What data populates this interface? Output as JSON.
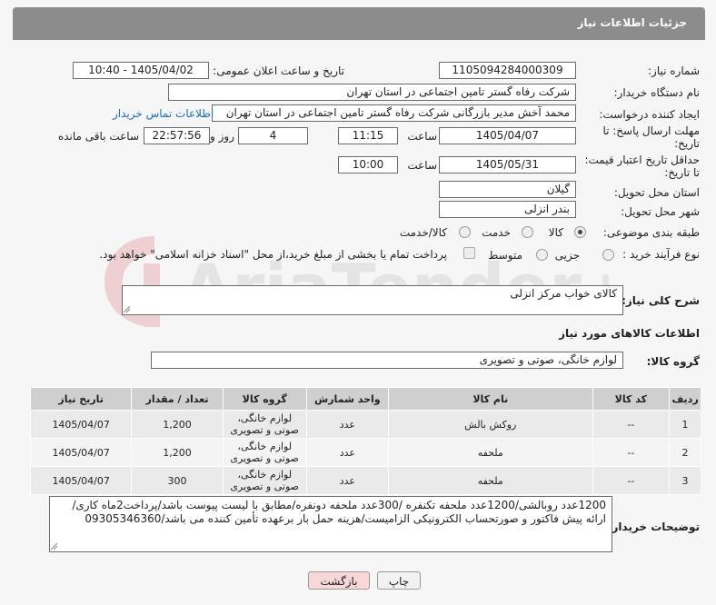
{
  "header": {
    "title": "جزئیات اطلاعات نیاز"
  },
  "need_number": {
    "label": "شماره نیاز:",
    "value": "1105094284000309"
  },
  "announce": {
    "label": "تاریخ و ساعت اعلان عمومی:",
    "value": "1405/04/02 - 10:40"
  },
  "buyer_org": {
    "label": "نام دستگاه خریدار:",
    "value": "شرکت رفاه گستر تامین اجتماعی در استان تهران"
  },
  "creator": {
    "label": "ایجاد کننده درخواست:",
    "value": "محمد آخش مدیر بازرگانی شرکت رفاه گستر تامین اجتماعی در استان تهران",
    "contact_link": "اطلاعات تماس خریدار"
  },
  "deadline": {
    "label_line1": "مهلت ارسال پاسخ: تا",
    "label_line2": "تاریخ:",
    "date": "1405/04/07",
    "time_label": "ساعت",
    "time": "11:15",
    "days": "4",
    "days_label": "روز و",
    "remaining": "22:57:56",
    "remaining_label": "ساعت باقی مانده"
  },
  "validity": {
    "label_line1": "حداقل تاریخ اعتبار قیمت:",
    "label_line2": "تا تاریخ:",
    "date": "1405/05/31",
    "time_label": "ساعت",
    "time": "10:00"
  },
  "province": {
    "label": "استان محل تحویل:",
    "value": "گیلان"
  },
  "city": {
    "label": "شهر محل تحویل:",
    "value": "بندر انزلی"
  },
  "category": {
    "label": "طبقه بندی موضوعی:",
    "options": [
      "کالا",
      "خدمت",
      "کالا/خدمت"
    ]
  },
  "process": {
    "label": "نوع فرآیند خرید :",
    "options": [
      "جزیی",
      "متوسط"
    ],
    "payment_note": "پرداخت تمام یا بخشی از مبلغ خرید،از محل \"اسناد خزانه اسلامی\" خواهد بود."
  },
  "general_desc": {
    "label": "شرح کلی نیاز:",
    "value": "کالای خواب مرکز انزلی"
  },
  "goods_info_title": "اطلاعات کالاهای مورد نیاز",
  "goods_group": {
    "label": "گروه کالا:",
    "value": "لوازم خانگی، صوتی و تصویری"
  },
  "table": {
    "headers": [
      "ردیف",
      "کد کالا",
      "نام کالا",
      "واحد شمارش",
      "گروه کالا",
      "تعداد / مقدار",
      "تاریخ نیاز"
    ],
    "rows": [
      [
        "1",
        "--",
        "روکش بالش",
        "عدد",
        "لوازم خانگی، صوتی و تصویری",
        "1,200",
        "1405/04/07"
      ],
      [
        "2",
        "--",
        "ملحفه",
        "عدد",
        "لوازم خانگی، صوتی و تصویری",
        "1,200",
        "1405/04/07"
      ],
      [
        "3",
        "--",
        "ملحفه",
        "عدد",
        "لوازم خانگی، صوتی و تصویری",
        "300",
        "1405/04/07"
      ]
    ]
  },
  "buyer_notes": {
    "label": "توضیحات خریدار:",
    "value": "1200عدد روبالشی/1200عدد ملحفه تکنفره /300عدد ملحفه دونفره/مطابق با لیست پیوست باشد/پرداخت2ماه کاری/ارائه پیش فاکتور و صورتحساب الکترونیکی الزامیست/هزینه حمل بار برعهده تأمین کننده می باشد/09305346360"
  },
  "buttons": {
    "print": "چاپ",
    "back": "بازگشت"
  },
  "watermark_text": "AriaTender.neT",
  "colors": {
    "header": "#8c8c8c",
    "link": "#1a6fb5",
    "back_button": "#f7d7d7"
  }
}
